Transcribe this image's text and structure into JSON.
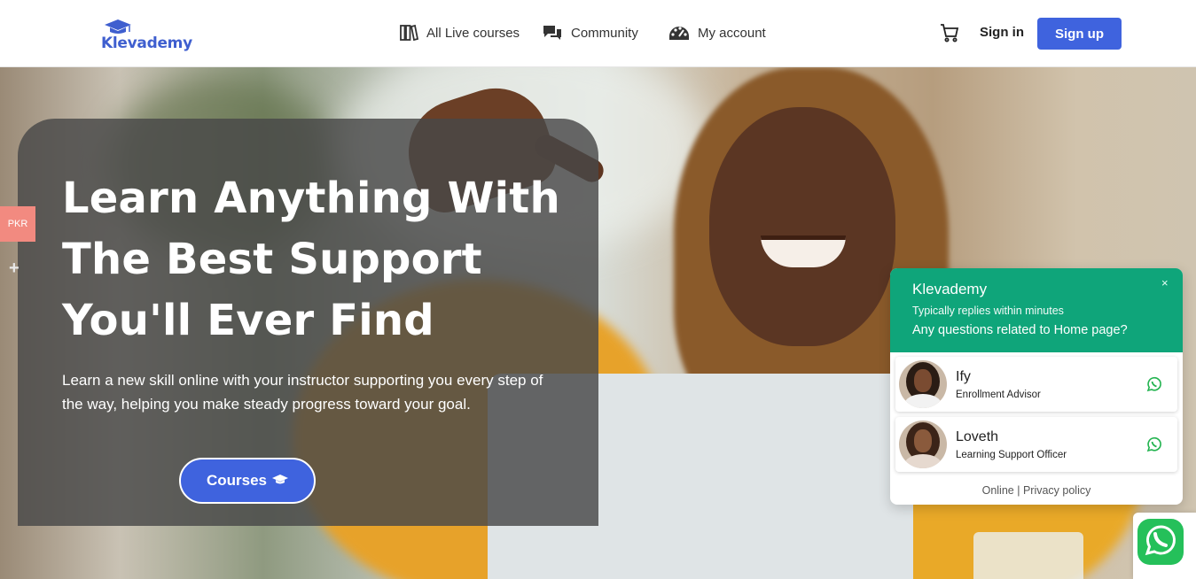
{
  "header": {
    "logo_text": "Klevademy",
    "nav": [
      {
        "label": "All Live courses",
        "icon": "books-icon"
      },
      {
        "label": "Community",
        "icon": "chat-bubbles-icon"
      },
      {
        "label": "My account",
        "icon": "dashboard-gauge-icon"
      }
    ],
    "cart_icon": "cart-icon",
    "signin_label": "Sign in",
    "signup_label": "Sign up",
    "accent_color": "#3f63de"
  },
  "hero": {
    "headline": "Learn Anything With The Best Support You'll Ever Find",
    "subtext": "Learn a new skill online with your instructor supporting you every step of the way, helping you make steady progress toward your goal.",
    "courses_button": "Courses",
    "courses_icon": "graduation-cap-icon"
  },
  "side": {
    "currency": "PKR",
    "plus": "+"
  },
  "chat": {
    "title": "Klevademy",
    "reply_time": "Typically replies within minutes",
    "question": "Any questions related to Home page?",
    "close": "×",
    "header_color": "#0fa57a",
    "agents": [
      {
        "name": "Ify",
        "role": "Enrollment Advisor"
      },
      {
        "name": "Loveth",
        "role": "Learning Support Officer"
      }
    ],
    "footer_online": "Online",
    "footer_sep": " | ",
    "footer_privacy": "Privacy policy"
  }
}
